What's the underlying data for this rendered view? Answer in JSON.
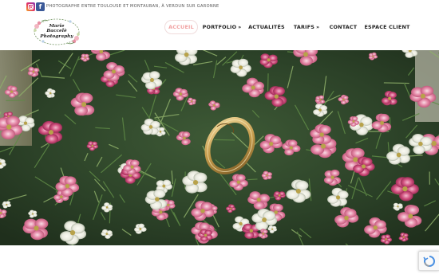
{
  "topbar": {
    "social": [
      {
        "name": "instagram-icon",
        "glyph": ""
      },
      {
        "name": "facebook-icon",
        "glyph": "f"
      }
    ],
    "tagline": "PHOTOGRAPHE ENTRE TOULOUSE ET MONTAUBAN, À VERDUN SUR GARONNE"
  },
  "logo": {
    "line1": "Marie",
    "line2": "Baccelè",
    "line3": "Photography"
  },
  "nav": {
    "items": [
      {
        "label": "ACCUEIL",
        "active": true,
        "dropdown": false
      },
      {
        "label": "PORTFOLIO",
        "active": false,
        "dropdown": true
      },
      {
        "label": "ACTUALITÉS",
        "active": false,
        "dropdown": false
      },
      {
        "label": "TARIFS",
        "active": false,
        "dropdown": true
      },
      {
        "label": "CONTACT",
        "active": false,
        "dropdown": false
      },
      {
        "label": "ESPACE CLIENT",
        "active": false,
        "dropdown": false
      }
    ],
    "dropdown_glyph": "»"
  },
  "hero": {
    "description_icon": "wedding-rings-flowers-photo"
  },
  "colors": {
    "accent": "#f1a1a1",
    "text": "#222222",
    "facebook": "#3b5998"
  }
}
